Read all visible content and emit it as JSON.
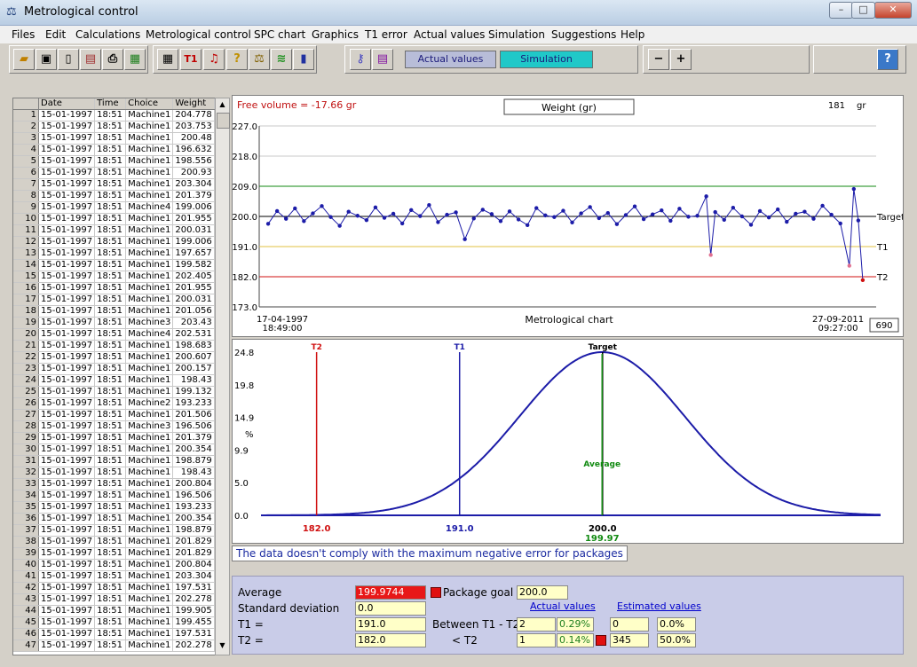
{
  "window": {
    "title": "Metrological control"
  },
  "menu": [
    "Files",
    "Edit",
    "Calculations",
    "Metrological control",
    "SPC chart",
    "Graphics",
    "T1 error",
    "Actual values",
    "Simulation",
    "Suggestions",
    "Help"
  ],
  "toolbar": {
    "actual_values": "Actual values",
    "simulation": "Simulation"
  },
  "grid": {
    "headers": [
      "Date",
      "Time",
      "Choice",
      "Weight"
    ],
    "rows": [
      [
        "1",
        "15-01-1997",
        "18:51",
        "Machine1",
        "204.778"
      ],
      [
        "2",
        "15-01-1997",
        "18:51",
        "Machine1",
        "203.753"
      ],
      [
        "3",
        "15-01-1997",
        "18:51",
        "Machine1",
        "200.48"
      ],
      [
        "4",
        "15-01-1997",
        "18:51",
        "Machine1",
        "196.632"
      ],
      [
        "5",
        "15-01-1997",
        "18:51",
        "Machine1",
        "198.556"
      ],
      [
        "6",
        "15-01-1997",
        "18:51",
        "Machine1",
        "200.93"
      ],
      [
        "7",
        "15-01-1997",
        "18:51",
        "Machine1",
        "203.304"
      ],
      [
        "8",
        "15-01-1997",
        "18:51",
        "Machine1",
        "201.379"
      ],
      [
        "9",
        "15-01-1997",
        "18:51",
        "Machine4",
        "199.006"
      ],
      [
        "10",
        "15-01-1997",
        "18:51",
        "Machine1",
        "201.955"
      ],
      [
        "11",
        "15-01-1997",
        "18:51",
        "Machine1",
        "200.031"
      ],
      [
        "12",
        "15-01-1997",
        "18:51",
        "Machine1",
        "199.006"
      ],
      [
        "13",
        "15-01-1997",
        "18:51",
        "Machine1",
        "197.657"
      ],
      [
        "14",
        "15-01-1997",
        "18:51",
        "Machine1",
        "199.582"
      ],
      [
        "15",
        "15-01-1997",
        "18:51",
        "Machine1",
        "202.405"
      ],
      [
        "16",
        "15-01-1997",
        "18:51",
        "Machine1",
        "201.955"
      ],
      [
        "17",
        "15-01-1997",
        "18:51",
        "Machine1",
        "200.031"
      ],
      [
        "18",
        "15-01-1997",
        "18:51",
        "Machine1",
        "201.056"
      ],
      [
        "19",
        "15-01-1997",
        "18:51",
        "Machine3",
        "203.43"
      ],
      [
        "20",
        "15-01-1997",
        "18:51",
        "Machine4",
        "202.531"
      ],
      [
        "21",
        "15-01-1997",
        "18:51",
        "Machine1",
        "198.683"
      ],
      [
        "22",
        "15-01-1997",
        "18:51",
        "Machine1",
        "200.607"
      ],
      [
        "23",
        "15-01-1997",
        "18:51",
        "Machine1",
        "200.157"
      ],
      [
        "24",
        "15-01-1997",
        "18:51",
        "Machine1",
        "198.43"
      ],
      [
        "25",
        "15-01-1997",
        "18:51",
        "Machine1",
        "199.132"
      ],
      [
        "26",
        "15-01-1997",
        "18:51",
        "Machine2",
        "193.233"
      ],
      [
        "27",
        "15-01-1997",
        "18:51",
        "Machine1",
        "201.506"
      ],
      [
        "28",
        "15-01-1997",
        "18:51",
        "Machine3",
        "196.506"
      ],
      [
        "29",
        "15-01-1997",
        "18:51",
        "Machine1",
        "201.379"
      ],
      [
        "30",
        "15-01-1997",
        "18:51",
        "Machine1",
        "200.354"
      ],
      [
        "31",
        "15-01-1997",
        "18:51",
        "Machine1",
        "198.879"
      ],
      [
        "32",
        "15-01-1997",
        "18:51",
        "Machine1",
        "198.43"
      ],
      [
        "33",
        "15-01-1997",
        "18:51",
        "Machine1",
        "200.804"
      ],
      [
        "34",
        "15-01-1997",
        "18:51",
        "Machine1",
        "196.506"
      ],
      [
        "35",
        "15-01-1997",
        "18:51",
        "Machine1",
        "193.233"
      ],
      [
        "36",
        "15-01-1997",
        "18:51",
        "Machine1",
        "200.354"
      ],
      [
        "37",
        "15-01-1997",
        "18:51",
        "Machine1",
        "198.879"
      ],
      [
        "38",
        "15-01-1997",
        "18:51",
        "Machine1",
        "201.829"
      ],
      [
        "39",
        "15-01-1997",
        "18:51",
        "Machine1",
        "201.829"
      ],
      [
        "40",
        "15-01-1997",
        "18:51",
        "Machine1",
        "200.804"
      ],
      [
        "41",
        "15-01-1997",
        "18:51",
        "Machine1",
        "203.304"
      ],
      [
        "42",
        "15-01-1997",
        "18:51",
        "Machine1",
        "197.531"
      ],
      [
        "43",
        "15-01-1997",
        "18:51",
        "Machine1",
        "202.278"
      ],
      [
        "44",
        "15-01-1997",
        "18:51",
        "Machine1",
        "199.905"
      ],
      [
        "45",
        "15-01-1997",
        "18:51",
        "Machine1",
        "199.455"
      ],
      [
        "46",
        "15-01-1997",
        "18:51",
        "Machine1",
        "197.531"
      ],
      [
        "47",
        "15-01-1997",
        "18:51",
        "Machine1",
        "202.278"
      ]
    ]
  },
  "chart_data": [
    {
      "type": "line",
      "title": "Weight (gr)",
      "xlabel": "Metrological chart",
      "free_volume": "Free volume = -17.66 gr",
      "current_value": "181",
      "unit": "gr",
      "sample_count": "690",
      "x_start": "17-04-1997",
      "x_start_time": "18:49:00",
      "x_end": "27-09-2011",
      "x_end_time": "09:27:00",
      "yticks": [
        "227.0",
        "218.0",
        "209.0",
        "200.0",
        "191.0",
        "182.0",
        "173.0"
      ],
      "ylim": [
        173,
        227
      ],
      "lines": [
        {
          "name": "Target",
          "value": 200,
          "color": "#000000"
        },
        {
          "name": "",
          "value": 209,
          "color": "#118a11"
        },
        {
          "name": "T1",
          "value": 191,
          "color": "#e0c040"
        },
        {
          "name": "T2",
          "value": 182,
          "color": "#d01010"
        }
      ],
      "series_color": "#1c1ca8",
      "points": [
        [
          10,
          197.8
        ],
        [
          20,
          201.6
        ],
        [
          30,
          199.3
        ],
        [
          40,
          202.4
        ],
        [
          50,
          198.6
        ],
        [
          60,
          200.9
        ],
        [
          70,
          203.1
        ],
        [
          80,
          199.8
        ],
        [
          90,
          197.2
        ],
        [
          100,
          201.4
        ],
        [
          110,
          200.2
        ],
        [
          120,
          198.9
        ],
        [
          130,
          202.7
        ],
        [
          140,
          199.6
        ],
        [
          150,
          200.8
        ],
        [
          160,
          197.9
        ],
        [
          170,
          201.9
        ],
        [
          180,
          200.1
        ],
        [
          190,
          203.4
        ],
        [
          200,
          198.3
        ],
        [
          210,
          200.5
        ],
        [
          220,
          201.2
        ],
        [
          230,
          193.2
        ],
        [
          240,
          199.4
        ],
        [
          250,
          202.0
        ],
        [
          260,
          200.7
        ],
        [
          270,
          198.6
        ],
        [
          280,
          201.5
        ],
        [
          290,
          199.1
        ],
        [
          300,
          197.4
        ],
        [
          310,
          202.5
        ],
        [
          320,
          200.3
        ],
        [
          330,
          199.8
        ],
        [
          340,
          201.7
        ],
        [
          350,
          198.2
        ],
        [
          360,
          200.9
        ],
        [
          370,
          202.8
        ],
        [
          380,
          199.5
        ],
        [
          390,
          201.0
        ],
        [
          400,
          197.7
        ],
        [
          410,
          200.4
        ],
        [
          420,
          203.0
        ],
        [
          430,
          199.2
        ],
        [
          440,
          200.6
        ],
        [
          450,
          201.8
        ],
        [
          460,
          198.7
        ],
        [
          470,
          202.3
        ],
        [
          480,
          199.9
        ],
        [
          490,
          200.2
        ],
        [
          500,
          206.0
        ],
        [
          505,
          188.5
        ],
        [
          510,
          201.3
        ],
        [
          520,
          199.0
        ],
        [
          530,
          202.6
        ],
        [
          540,
          200.0
        ],
        [
          550,
          197.5
        ],
        [
          560,
          201.6
        ],
        [
          570,
          199.7
        ],
        [
          580,
          202.1
        ],
        [
          590,
          198.4
        ],
        [
          600,
          200.8
        ],
        [
          610,
          201.4
        ],
        [
          620,
          199.3
        ],
        [
          630,
          203.2
        ],
        [
          640,
          200.5
        ],
        [
          650,
          197.9
        ],
        [
          660,
          185.3
        ],
        [
          665,
          208.2
        ],
        [
          670,
          198.8
        ],
        [
          675,
          181.0
        ]
      ]
    },
    {
      "type": "area",
      "title": "",
      "ylabel": "%",
      "yticks": [
        "24.8",
        "19.8",
        "14.9",
        "9.9",
        "5.0",
        "0.0"
      ],
      "ylim": [
        0,
        24.8
      ],
      "markers": [
        {
          "name": "T2",
          "x": 182.0,
          "label": "182.0",
          "color": "#d01010"
        },
        {
          "name": "T1",
          "x": 191.0,
          "label": "191.0",
          "color": "#1c1ca8"
        },
        {
          "name": "Target",
          "x": 200.0,
          "label": "200.0",
          "color": "#000000"
        },
        {
          "name": "Average",
          "x": 199.97,
          "label": "199.97",
          "color": "#118a11"
        }
      ],
      "curve": {
        "mean": 199.97,
        "sd": 2.0,
        "peak": 24.8
      },
      "xrange": [
        178.5,
        217.5
      ],
      "series_color": "#1c1ca8"
    }
  ],
  "status": "The data doesn't comply with the maximum negative error for packages",
  "stats": {
    "average_label": "Average",
    "average": "199.9744",
    "std_label": "Standard deviation",
    "std": "0.0",
    "t1_label": "T1 =",
    "t1": "191.0",
    "t2_label": "T2 =",
    "t2": "182.0",
    "package_goal_label": "Package goal =",
    "package_goal": "200.0",
    "actual_header": "Actual values",
    "estimated_header": "Estimated values",
    "between_label": "Between T1 - T2",
    "below_label": "< T2",
    "between_actual_n": "2",
    "between_actual_pct": "0.29%",
    "between_est_n": "0",
    "between_est_pct": "0.0%",
    "below_actual_n": "1",
    "below_actual_pct": "0.14%",
    "below_est_n": "345",
    "below_est_pct": "50.0%"
  }
}
